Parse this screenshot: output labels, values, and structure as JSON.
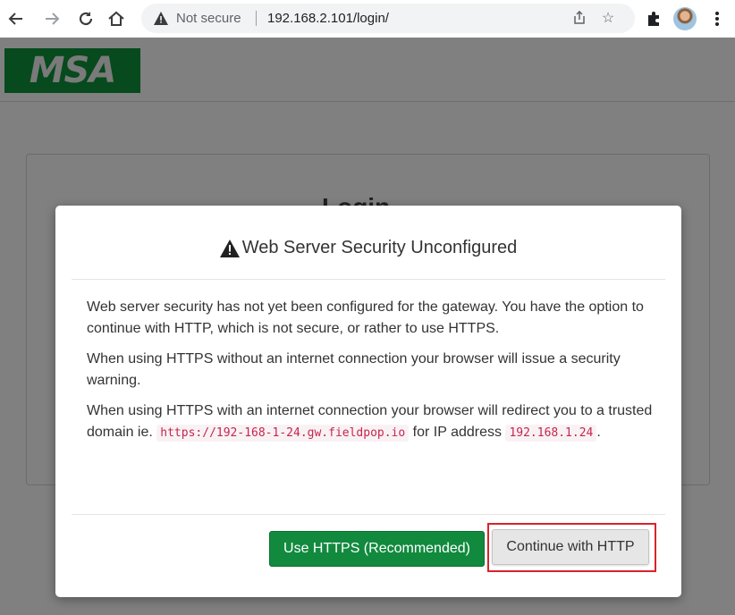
{
  "browser": {
    "security_label": "Not secure",
    "url": "192.168.2.101/login/",
    "icons": [
      "back-arrow-icon",
      "forward-arrow-icon",
      "reload-icon",
      "home-icon",
      "warning-icon",
      "share-icon",
      "star-icon",
      "extensions-puzzle-icon",
      "profile-avatar",
      "more-vert-icon"
    ]
  },
  "page": {
    "logo_text": "MSA",
    "login_peek": "Login"
  },
  "modal": {
    "title": "Web Server Security Unconfigured",
    "paragraph1": "Web server security has not yet been configured for the gateway. You have the option to continue with HTTP, which is not secure, or rather to use HTTPS.",
    "paragraph2": "When using HTTPS without an internet connection your browser will issue a security warning.",
    "paragraph3_before": "When using HTTPS with an internet connection your browser will redirect you to a trusted domain ie.",
    "domain_code": "https://192-168-1-24.gw.fieldpop.io",
    "paragraph3_middle": "for IP address",
    "ip_code": "192.168.1.24",
    "paragraph3_end": ".",
    "https_button": "Use HTTPS (Recommended)",
    "http_button": "Continue with HTTP"
  },
  "colors": {
    "primary_green": "#118a3e",
    "highlight_red": "#d9232c",
    "code_pink": "#c7254e",
    "logo_green": "#064a1d"
  }
}
